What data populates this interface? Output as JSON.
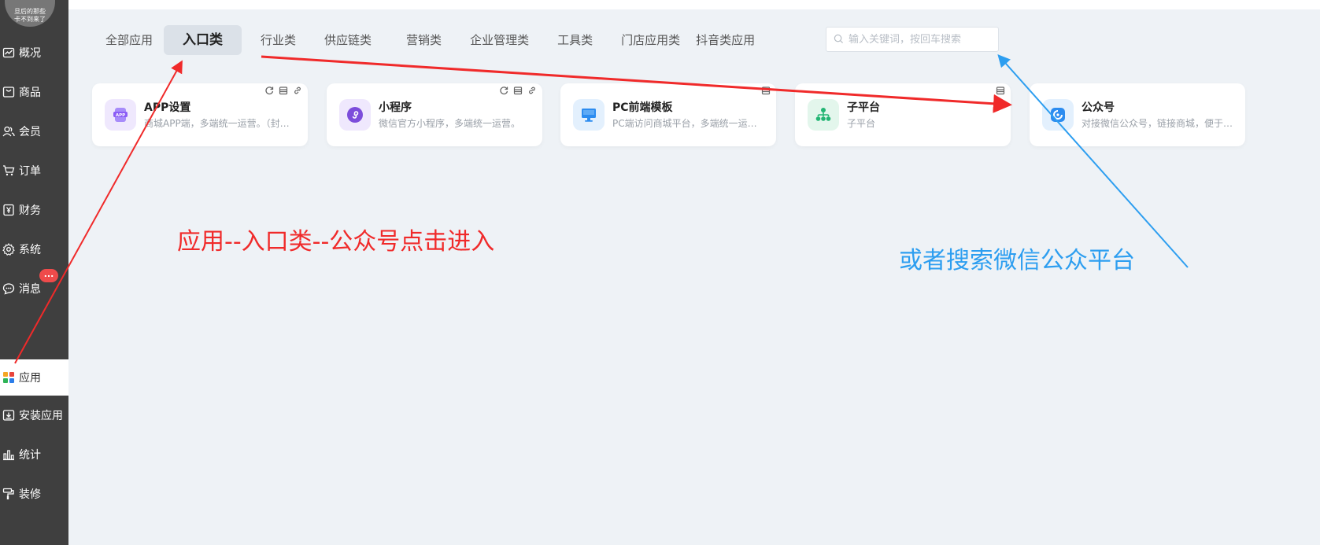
{
  "sidebar": {
    "avatar_text_1": "旦后的那些",
    "avatar_text_2": "卡不到来了",
    "items": [
      {
        "label": "概况",
        "icon": "chart-line-icon"
      },
      {
        "label": "商品",
        "icon": "product-icon"
      },
      {
        "label": "会员",
        "icon": "users-icon"
      },
      {
        "label": "订单",
        "icon": "cart-icon"
      },
      {
        "label": "财务",
        "icon": "yen-icon"
      },
      {
        "label": "系统",
        "icon": "gear-icon"
      },
      {
        "label": "消息",
        "icon": "chat-icon"
      },
      {
        "label": "应用",
        "icon": "apps-grid-icon"
      },
      {
        "label": "安装应用",
        "icon": "install-icon"
      },
      {
        "label": "统计",
        "icon": "bar-chart-icon"
      },
      {
        "label": "装修",
        "icon": "paint-roller-icon"
      }
    ],
    "message_badge": "...",
    "active_item": "应用"
  },
  "tabs": [
    "全部应用",
    "入口类",
    "行业类",
    "供应链类",
    "营销类",
    "企业管理类",
    "工具类",
    "门店应用类",
    "抖音类应用"
  ],
  "active_tab": "入口类",
  "search": {
    "placeholder": "输入关键词，按回车搜索",
    "icon": "search-icon"
  },
  "cards": [
    {
      "title": "APP设置",
      "desc": "商城APP端，多端统一运营。（封…",
      "icon": "app-icon",
      "color": "#8b5cf6"
    },
    {
      "title": "小程序",
      "desc": "微信官方小程序，多端统一运营。",
      "icon": "miniprogram-icon",
      "color": "#7c4ddb"
    },
    {
      "title": "PC前端模板",
      "desc": "PC端访问商城平台，多端统一运…",
      "icon": "monitor-icon",
      "color": "#2c8cf0"
    },
    {
      "title": "子平台",
      "desc": "子平台",
      "icon": "org-tree-icon",
      "color": "#22b573"
    },
    {
      "title": "公众号",
      "desc": "对接微信公众号，链接商城，便于…",
      "icon": "wechat-official-icon",
      "color": "#2c8cf0"
    }
  ],
  "annotations": {
    "red": "应用--入口类--公众号点击进入",
    "blue": "或者搜索微信公众平台"
  },
  "colors": {
    "annotation_red": "#f02a2a",
    "annotation_blue": "#2d9ef0",
    "sidebar_bg": "#3f3f3f",
    "page_bg": "#eef2f6"
  }
}
